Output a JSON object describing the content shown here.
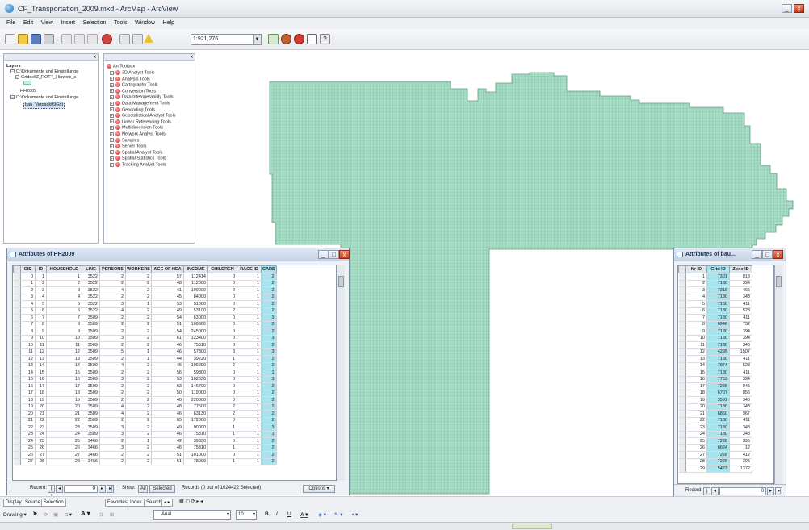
{
  "window": {
    "title": "CF_Transportation_2009.mxd - ArcMap - ArcView"
  },
  "menu": [
    "File",
    "Edit",
    "View",
    "Insert",
    "Selection",
    "Tools",
    "Window",
    "Help"
  ],
  "toolbar": {
    "scale": "1:921,276"
  },
  "toc": {
    "title": "Layers",
    "items": [
      "C:\\Dokumente und Einstellunge",
      "GridcellZ_ROTT_Hinweis_s",
      "HH2009",
      "C:\\Dokumente und Einstellunge",
      "bau_Verpack09Gr.t"
    ]
  },
  "arctoolbox": {
    "title": "ArcToolbox",
    "items": [
      "3D Analyst Tools",
      "Analysis Tools",
      "Cartography Tools",
      "Conversion Tools",
      "Data Interoperability Tools",
      "Data Management Tools",
      "Geocoding Tools",
      "Geostatistical Analyst Tools",
      "Linear Referencing Tools",
      "Multidimension Tools",
      "Network Analyst Tools",
      "Samples",
      "Server Tools",
      "Spatial Analyst Tools",
      "Spatial Statistics Tools",
      "Tracking Analyst Tools"
    ]
  },
  "colors": {
    "map_fill": "#a9dcc6",
    "map_grid": "#7fbea4",
    "highlight_column": "#a8e4ee"
  },
  "attributes_main": {
    "title": "Attributes of HH2009",
    "columns": [
      "OID",
      "ID",
      "HOUSEHOLD",
      "LINE",
      "PERSONS",
      "WORKERS",
      "AGE OF HEA",
      "INCOME",
      "CHILDREN",
      "RACE ID",
      "CARS"
    ],
    "rows": [
      [
        "0",
        "1",
        "1",
        "3522",
        "2",
        "2",
        "57",
        "112414",
        "0",
        "1",
        "2"
      ],
      [
        "1",
        "2",
        "2",
        "3522",
        "2",
        "2",
        "48",
        "112000",
        "0",
        "1",
        "2"
      ],
      [
        "2",
        "3",
        "3",
        "3522",
        "4",
        "2",
        "41",
        "199000",
        "2",
        "1",
        "2"
      ],
      [
        "3",
        "4",
        "4",
        "3522",
        "2",
        "2",
        "45",
        "84000",
        "0",
        "1",
        "2"
      ],
      [
        "4",
        "5",
        "5",
        "3522",
        "3",
        "1",
        "53",
        "51000",
        "0",
        "1",
        "2"
      ],
      [
        "5",
        "6",
        "6",
        "3522",
        "4",
        "2",
        "49",
        "53100",
        "2",
        "1",
        "2"
      ],
      [
        "6",
        "7",
        "7",
        "3509",
        "2",
        "2",
        "54",
        "63000",
        "0",
        "1",
        "3"
      ],
      [
        "7",
        "8",
        "8",
        "3509",
        "2",
        "2",
        "51",
        "109600",
        "0",
        "1",
        "2"
      ],
      [
        "8",
        "9",
        "9",
        "3509",
        "2",
        "2",
        "54",
        "245000",
        "0",
        "1",
        "2"
      ],
      [
        "9",
        "10",
        "10",
        "3509",
        "3",
        "2",
        "61",
        "123400",
        "0",
        "1",
        "3"
      ],
      [
        "10",
        "11",
        "11",
        "3509",
        "2",
        "2",
        "46",
        "75310",
        "0",
        "1",
        "2"
      ],
      [
        "11",
        "12",
        "12",
        "3509",
        "5",
        "1",
        "46",
        "57300",
        "3",
        "1",
        "3"
      ],
      [
        "12",
        "13",
        "13",
        "3509",
        "2",
        "1",
        "44",
        "39220",
        "1",
        "1",
        "2"
      ],
      [
        "13",
        "14",
        "14",
        "3509",
        "4",
        "2",
        "46",
        "106200",
        "2",
        "1",
        "2"
      ],
      [
        "14",
        "15",
        "15",
        "3509",
        "2",
        "2",
        "56",
        "59800",
        "0",
        "1",
        "1"
      ],
      [
        "15",
        "16",
        "16",
        "3509",
        "3",
        "2",
        "53",
        "102630",
        "0",
        "1",
        "3"
      ],
      [
        "16",
        "17",
        "17",
        "3509",
        "2",
        "2",
        "63",
        "146700",
        "0",
        "1",
        "2"
      ],
      [
        "17",
        "18",
        "18",
        "3509",
        "2",
        "2",
        "50",
        "119000",
        "0",
        "1",
        "2"
      ],
      [
        "18",
        "19",
        "19",
        "3509",
        "2",
        "2",
        "40",
        "220000",
        "0",
        "1",
        "2"
      ],
      [
        "19",
        "20",
        "20",
        "3509",
        "4",
        "2",
        "48",
        "77500",
        "2",
        "1",
        "2"
      ],
      [
        "20",
        "21",
        "21",
        "3509",
        "4",
        "2",
        "46",
        "63130",
        "2",
        "1",
        "2"
      ],
      [
        "21",
        "22",
        "22",
        "3509",
        "2",
        "2",
        "65",
        "172000",
        "0",
        "1",
        "2"
      ],
      [
        "22",
        "23",
        "23",
        "3509",
        "3",
        "2",
        "49",
        "90000",
        "1",
        "1",
        "3"
      ],
      [
        "23",
        "24",
        "24",
        "3509",
        "3",
        "2",
        "46",
        "75310",
        "1",
        "1",
        "1"
      ],
      [
        "24",
        "25",
        "25",
        "3466",
        "2",
        "1",
        "42",
        "39330",
        "0",
        "1",
        "2"
      ],
      [
        "25",
        "26",
        "26",
        "3466",
        "3",
        "2",
        "46",
        "75310",
        "1",
        "1",
        "2"
      ],
      [
        "26",
        "27",
        "27",
        "3466",
        "2",
        "2",
        "51",
        "101000",
        "0",
        "1",
        "2"
      ],
      [
        "27",
        "28",
        "28",
        "3466",
        "2",
        "2",
        "51",
        "78000",
        "1",
        "1",
        "2"
      ]
    ],
    "record_label": "Record:",
    "record_value": "0",
    "show_label": "Show:",
    "all_label": "All",
    "selected_label": "Selected",
    "records_text": "Records (0 out of 1024422 Selected)",
    "options_label": "Options"
  },
  "attributes_small": {
    "title": "Attributes of bau...",
    "columns": [
      "Nr ID",
      "Grid ID",
      "Zone ID"
    ],
    "rows": [
      [
        "1",
        "7301",
        "818"
      ],
      [
        "2",
        "7180",
        "394"
      ],
      [
        "3",
        "7318",
        "466"
      ],
      [
        "4",
        "7180",
        "343"
      ],
      [
        "5",
        "7180",
        "411"
      ],
      [
        "6",
        "7180",
        "528"
      ],
      [
        "7",
        "7180",
        "411"
      ],
      [
        "8",
        "6946",
        "732"
      ],
      [
        "9",
        "7180",
        "394"
      ],
      [
        "10",
        "7180",
        "394"
      ],
      [
        "11",
        "7180",
        "343"
      ],
      [
        "12",
        "4295",
        "1507"
      ],
      [
        "13",
        "7180",
        "411"
      ],
      [
        "14",
        "7874",
        "528"
      ],
      [
        "15",
        "7180",
        "411"
      ],
      [
        "16",
        "7753",
        "394"
      ],
      [
        "17",
        "7228",
        "945"
      ],
      [
        "18",
        "6707",
        "856"
      ],
      [
        "19",
        "3591",
        "340"
      ],
      [
        "20",
        "7180",
        "343"
      ],
      [
        "21",
        "6860",
        "967"
      ],
      [
        "22",
        "7180",
        "411"
      ],
      [
        "23",
        "7180",
        "343"
      ],
      [
        "24",
        "7180",
        "343"
      ],
      [
        "25",
        "7228",
        "395"
      ],
      [
        "26",
        "6624",
        "12"
      ],
      [
        "27",
        "7228",
        "412"
      ],
      [
        "28",
        "7228",
        "395"
      ],
      [
        "29",
        "5423",
        "1372"
      ]
    ],
    "record_label": "Record:",
    "record_value": "0"
  },
  "tabs": [
    "Display",
    "Source",
    "Selection"
  ],
  "tabs2": [
    "Favorites",
    "Index",
    "Search"
  ],
  "drawing": {
    "label": "Drawing",
    "font": "Arial",
    "size": "10",
    "bold": "B",
    "italic": "I",
    "underline": "U",
    "text_tool": "A"
  }
}
